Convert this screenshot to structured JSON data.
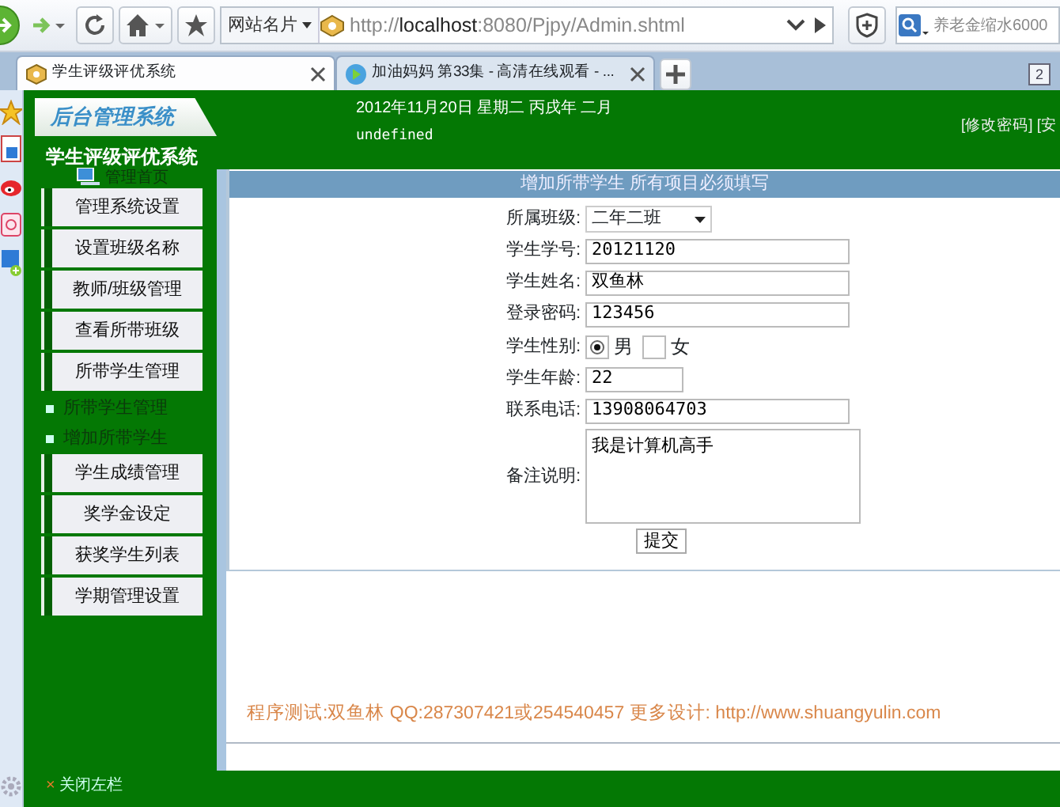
{
  "browser": {
    "site_card": "网站名片",
    "url": "http://**localhost**:8080/Pjpy/Admin.shtml",
    "search": {
      "placeholder": "养老金缩水6000"
    },
    "tabs": [
      {
        "title": "学生评级评优系统",
        "selected": true
      },
      {
        "title": "加油妈妈 第33集 - 高清在线观看 - ...",
        "selected": false
      }
    ],
    "tab_count": "2"
  },
  "header": {
    "logo": "后台管理系统",
    "date": "2012年11月20日 星期二 丙戌年 二月",
    "user": "undefined",
    "links": "[修改密码] [安"
  },
  "sidebar": {
    "title": "学生评级评优系统",
    "home": "管理首页",
    "items": [
      {
        "kind": "button",
        "label": "管理系统设置"
      },
      {
        "kind": "button",
        "label": "设置班级名称"
      },
      {
        "kind": "button",
        "label": "教师/班级管理"
      },
      {
        "kind": "button",
        "label": "查看所带班级"
      },
      {
        "kind": "button",
        "label": "所带学生管理"
      },
      {
        "kind": "subitem",
        "label": "所带学生管理"
      },
      {
        "kind": "subitem",
        "label": "增加所带学生"
      },
      {
        "kind": "button",
        "label": "学生成绩管理"
      },
      {
        "kind": "button",
        "label": "奖学金设定"
      },
      {
        "kind": "button",
        "label": "获奖学生列表"
      },
      {
        "kind": "button",
        "label": "学期管理设置"
      }
    ],
    "close": {
      "icon": "×",
      "label": "关闭左栏"
    }
  },
  "form": {
    "title": "增加所带学生 所有项目必须填写",
    "fields": [
      {
        "kind": "select",
        "label": "所属班级:",
        "value": "二年二班"
      },
      {
        "kind": "text",
        "label": "学生学号:",
        "value": "20121120"
      },
      {
        "kind": "text",
        "label": "学生姓名:",
        "value": "双鱼林"
      },
      {
        "kind": "text",
        "label": "登录密码:",
        "value": "123456"
      },
      {
        "kind": "radio",
        "label": "学生性别:",
        "options": [
          {
            "label": "男",
            "selected": true
          },
          {
            "label": "女",
            "selected": false
          }
        ]
      },
      {
        "kind": "short",
        "label": "学生年龄:",
        "value": "22"
      },
      {
        "kind": "text",
        "label": "联系电话:",
        "value": "13908064703"
      },
      {
        "kind": "textarea",
        "label": "备注说明:",
        "value": "我是计算机高手"
      }
    ],
    "submit": "提交"
  },
  "footer": "程序测试:双鱼林 QQ:287307421或254540457 更多设计: http://www.shuangyulin.com"
}
